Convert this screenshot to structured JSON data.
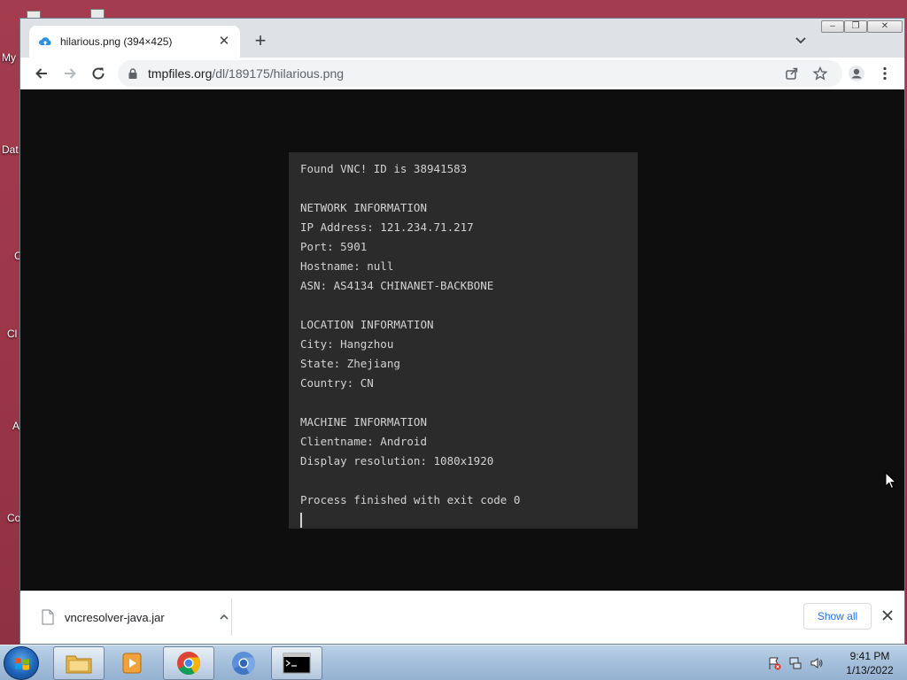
{
  "desktop": {
    "labels": [
      "My",
      "Dat",
      "C",
      "Cl",
      "A",
      "Co"
    ]
  },
  "browser": {
    "tab": {
      "title": "hilarious.png (394×425)"
    },
    "omnibox": {
      "host": "tmpfiles.org",
      "path": "/dl/189175/hilarious.png"
    }
  },
  "image_text": {
    "lines": [
      "Found VNC! ID is 38941583",
      "",
      "NETWORK INFORMATION",
      "IP Address: 121.234.71.217",
      "Port: 5901",
      "Hostname: null",
      "ASN: AS4134 CHINANET-BACKBONE",
      "",
      "LOCATION INFORMATION",
      "City: Hangzhou",
      "State: Zhejiang",
      "Country: CN",
      "",
      "MACHINE INFORMATION",
      "Clientname: Android",
      "Display resolution: 1080x1920",
      "",
      "Process finished with exit code 0"
    ]
  },
  "download_shelf": {
    "file_name": "vncresolver-java.jar",
    "show_all_label": "Show all"
  },
  "taskbar": {
    "clock_time": "9:41 PM",
    "clock_date": "1/13/2022",
    "pinned": [
      "explorer-icon",
      "media-player-icon",
      "chrome-icon",
      "chromium-icon",
      "cmd-icon"
    ]
  },
  "colors": {
    "desktop_bg": "#9b3a4a",
    "image_bg": "#2b2b2b",
    "terminal_text": "#d2d2d2",
    "link_blue": "#1a73e8"
  }
}
